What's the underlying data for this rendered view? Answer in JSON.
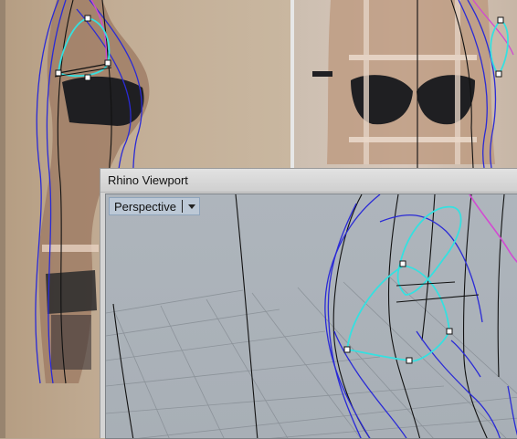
{
  "window": {
    "title": "Rhino Viewport"
  },
  "viewport": {
    "name": "Perspective",
    "dropdown_icon": "triangle-down"
  },
  "colors": {
    "curve_blue": "#2a2ad6",
    "curve_black": "#111111",
    "curve_cyan": "#35e0e0",
    "curve_magenta": "#d24ad2",
    "grid": "#8c939a"
  }
}
